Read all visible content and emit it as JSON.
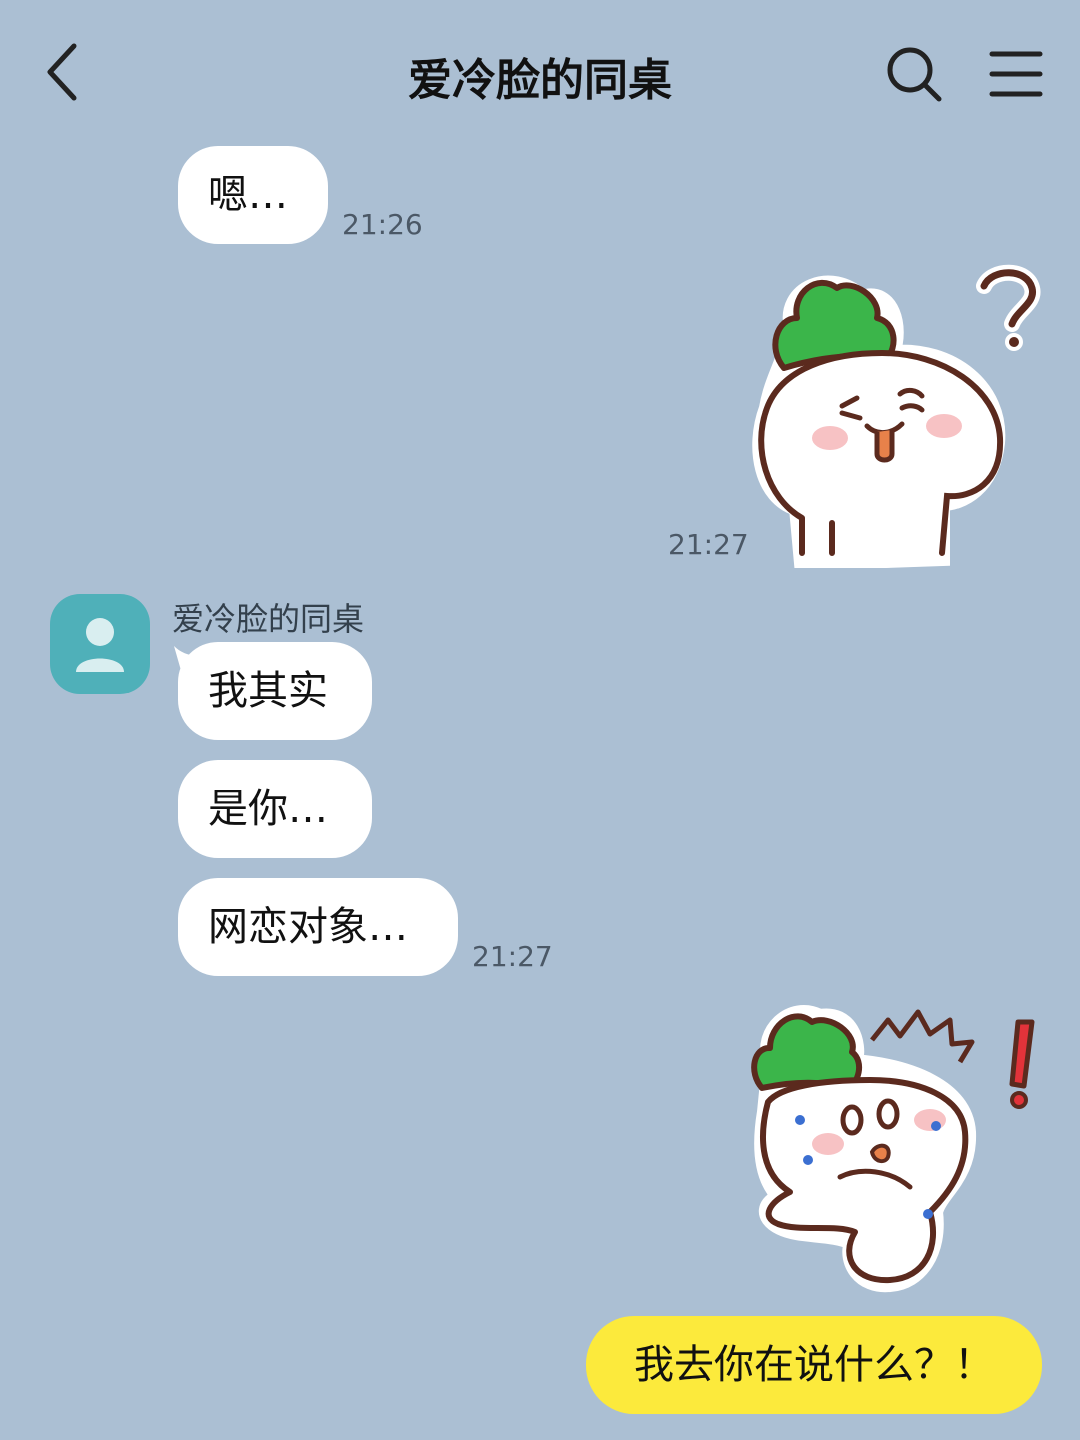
{
  "header": {
    "title": "爱冷脸的同桌",
    "back_icon": "chevron-left-icon",
    "search_icon": "search-icon",
    "menu_icon": "menu-icon"
  },
  "messages": {
    "m1": {
      "text": "嗯…",
      "time": "21:26"
    },
    "sticker1": {
      "name": "radish-confused-sticker",
      "time": "21:27"
    },
    "group": {
      "sender": "爱冷脸的同桌",
      "lines": [
        "我其实",
        "是你…",
        "网恋对象…"
      ],
      "time": "21:27"
    },
    "sticker2": {
      "name": "radish-shocked-sticker"
    },
    "reply": {
      "text": "我去你在说什么？！"
    }
  },
  "colors": {
    "background": "#abbfd3",
    "bubble": "#ffffff",
    "my_bubble": "#fcea3c",
    "avatar": "#4fb0b9"
  }
}
